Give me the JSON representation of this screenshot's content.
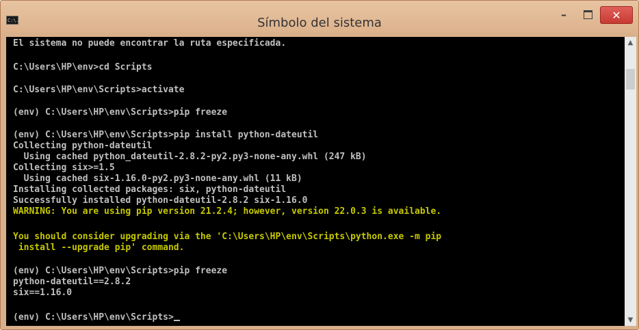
{
  "window": {
    "title": "Símbolo del sistema",
    "icon_text": "C:\\.",
    "buttons": {
      "minimize": "–",
      "close": "✕"
    }
  },
  "console": {
    "lines": [
      {
        "text": "El sistema no puede encontrar la ruta especificada.",
        "type": "output"
      },
      {
        "text": "C:\\Users\\HP\\env>cd Scripts",
        "type": "command"
      },
      {
        "text": "C:\\Users\\HP\\env\\Scripts>activate",
        "type": "command"
      },
      {
        "text": "(env) C:\\Users\\HP\\env\\Scripts>pip freeze",
        "type": "command"
      },
      {
        "text": "(env) C:\\Users\\HP\\env\\Scripts>pip install python-dateutil",
        "type": "command"
      },
      {
        "text": "Collecting python-dateutil",
        "type": "output"
      },
      {
        "text": "  Using cached python_dateutil-2.8.2-py2.py3-none-any.whl (247 kB)",
        "type": "output"
      },
      {
        "text": "Collecting six>=1.5",
        "type": "output"
      },
      {
        "text": "  Using cached six-1.16.0-py2.py3-none-any.whl (11 kB)",
        "type": "output"
      },
      {
        "text": "Installing collected packages: six, python-dateutil",
        "type": "output"
      },
      {
        "text": "Successfully installed python-dateutil-2.8.2 six-1.16.0",
        "type": "output"
      },
      {
        "text": "WARNING: You are using pip version 21.2.4; however, version 22.0.3 is available.",
        "type": "warning"
      },
      {
        "text": "You should consider upgrading via the 'C:\\Users\\HP\\env\\Scripts\\python.exe -m pip",
        "type": "warning"
      },
      {
        "text": " install --upgrade pip' command.",
        "type": "warning"
      },
      {
        "text": "(env) C:\\Users\\HP\\env\\Scripts>pip freeze",
        "type": "command"
      },
      {
        "text": "python-dateutil==2.8.2",
        "type": "output"
      },
      {
        "text": "six==1.16.0",
        "type": "output"
      },
      {
        "text": "(env) C:\\Users\\HP\\env\\Scripts>",
        "type": "prompt"
      }
    ]
  },
  "scrollbar": {
    "up_arrow": "▲",
    "down_arrow": "▼"
  },
  "colors": {
    "console_background": "#000000",
    "console_text": "#c0c0c0",
    "warning_text": "#c6c900",
    "close_button": "#c83a32",
    "titlebar": "#dcb28c"
  }
}
